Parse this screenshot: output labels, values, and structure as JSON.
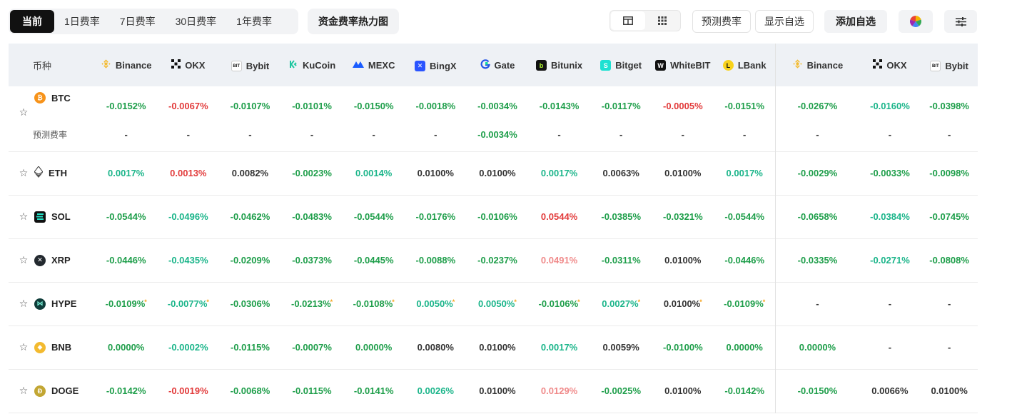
{
  "tabs": [
    "当前",
    "1日费率",
    "7日费率",
    "30日费率",
    "1年费率"
  ],
  "heatmap_button": "资金费率热力图",
  "toolbar": {
    "predict_label": "预测费率",
    "show_watchlist_label": "显示自选",
    "add_watchlist_label": "添加自选"
  },
  "table": {
    "coin_header": "币种",
    "exchanges": [
      "Binance",
      "OKX",
      "Bybit",
      "KuCoin",
      "MEXC",
      "BingX",
      "Gate",
      "Bitunix",
      "Bitget",
      "WhiteBIT",
      "LBank",
      "Binance",
      "OKX",
      "Bybit"
    ],
    "predicted_label": "预测费率",
    "rows": [
      {
        "coin": "BTC",
        "rates": [
          "-0.0152%",
          "-0.0067%",
          "-0.0107%",
          "-0.0101%",
          "-0.0150%",
          "-0.0018%",
          "-0.0034%",
          "-0.0143%",
          "-0.0117%",
          "-0.0005%",
          "-0.0151%",
          "-0.0267%",
          "-0.0160%",
          "-0.0398%"
        ],
        "predicted": [
          "-",
          "-",
          "-",
          "-",
          "-",
          "-",
          "-0.0034%",
          "-",
          "-",
          "-",
          "-",
          "-",
          "-",
          "-"
        ]
      },
      {
        "coin": "ETH",
        "rates": [
          "0.0017%",
          "0.0013%",
          "0.0082%",
          "-0.0023%",
          "0.0014%",
          "0.0100%",
          "0.0100%",
          "0.0017%",
          "0.0063%",
          "0.0100%",
          "0.0017%",
          "-0.0029%",
          "-0.0033%",
          "-0.0098%"
        ]
      },
      {
        "coin": "SOL",
        "rates": [
          "-0.0544%",
          "-0.0496%",
          "-0.0462%",
          "-0.0483%",
          "-0.0544%",
          "-0.0176%",
          "-0.0106%",
          "0.0544%",
          "-0.0385%",
          "-0.0321%",
          "-0.0544%",
          "-0.0658%",
          "-0.0384%",
          "-0.0745%"
        ]
      },
      {
        "coin": "XRP",
        "rates": [
          "-0.0446%",
          "-0.0435%",
          "-0.0209%",
          "-0.0373%",
          "-0.0445%",
          "-0.0088%",
          "-0.0237%",
          "0.0491%",
          "-0.0311%",
          "0.0100%",
          "-0.0446%",
          "-0.0335%",
          "-0.0271%",
          "-0.0808%"
        ]
      },
      {
        "coin": "HYPE",
        "rates": [
          "-0.0109%",
          "-0.0077%",
          "-0.0306%",
          "-0.0213%",
          "-0.0108%",
          "0.0050%",
          "0.0050%",
          "-0.0106%",
          "0.0027%",
          "0.0100%",
          "-0.0109%",
          "-",
          "-",
          "-"
        ]
      },
      {
        "coin": "BNB",
        "rates": [
          "0.0000%",
          "-0.0002%",
          "-0.0115%",
          "-0.0007%",
          "0.0000%",
          "0.0080%",
          "0.0100%",
          "0.0017%",
          "0.0059%",
          "-0.0100%",
          "0.0000%",
          "0.0000%",
          "-",
          "-"
        ]
      },
      {
        "coin": "DOGE",
        "rates": [
          "-0.0142%",
          "-0.0019%",
          "-0.0068%",
          "-0.0115%",
          "-0.0141%",
          "0.0026%",
          "0.0100%",
          "0.0129%",
          "-0.0025%",
          "0.0100%",
          "-0.0142%",
          "-0.0150%",
          "0.0066%",
          "0.0100%"
        ]
      }
    ]
  },
  "colors": {
    "positive": "#1e9e4a",
    "negative": "#e23b3b",
    "teal": "#1bb58a",
    "light_negative": "#f08a8a",
    "neutral": "#333333",
    "header_bg": "#eef1f5"
  }
}
